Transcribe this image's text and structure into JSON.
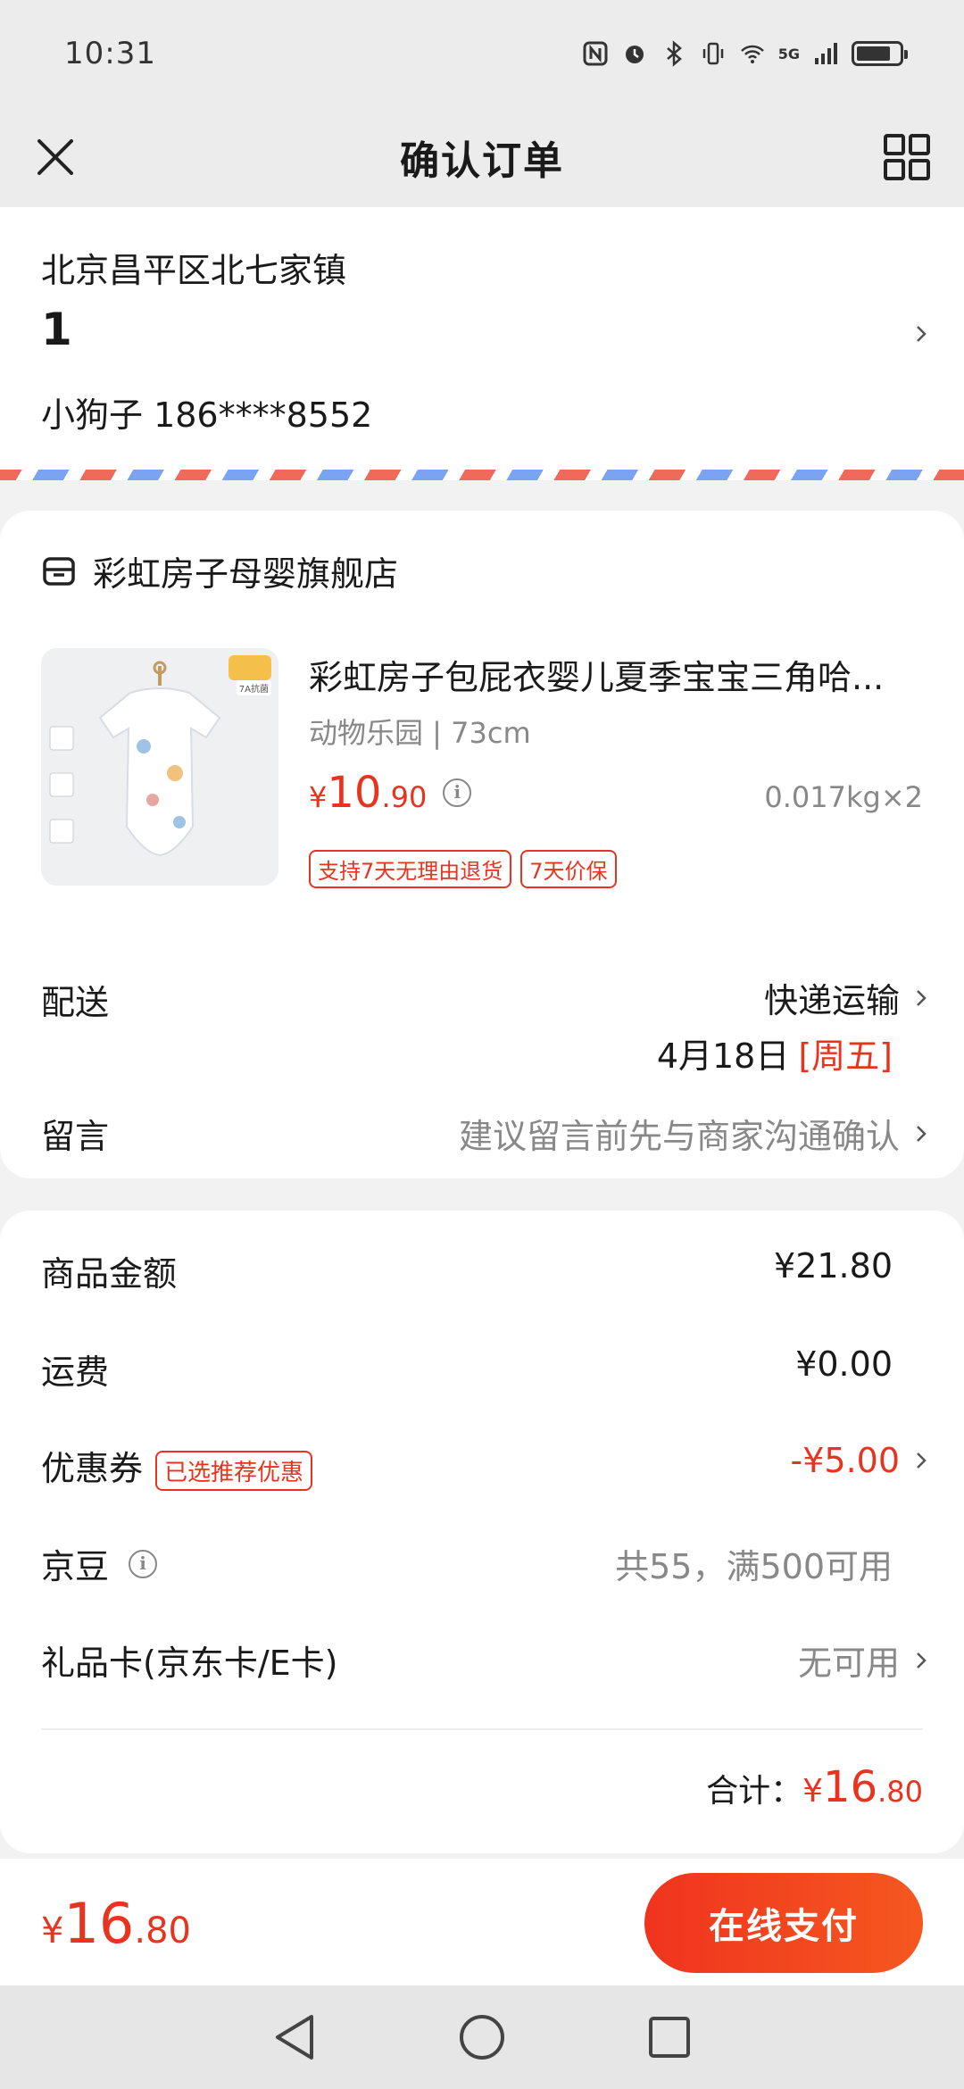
{
  "status_bar": {
    "time": "10:31",
    "network": "5G"
  },
  "header": {
    "title": "确认订单"
  },
  "address": {
    "region": "北京昌平区北七家镇",
    "detail": "1",
    "contact": "小狗子 186****8552"
  },
  "shop": {
    "name": "彩虹房子母婴旗舰店",
    "product": {
      "title": "彩虹房子包屁衣婴儿夏季宝宝三角哈...",
      "spec": "动物乐园 | 73cm",
      "price_currency": "¥",
      "price_int": "10",
      "price_dec": ".90",
      "weight": "0.017kg×2",
      "tags": [
        "支持7天无理由退货",
        "7天价保"
      ],
      "image_badge": "7A抗菌"
    },
    "delivery": {
      "label": "配送",
      "method": "快递运输",
      "date": "4月18日",
      "weekday": "[周五]"
    },
    "message": {
      "label": "留言",
      "placeholder": "建议留言前先与商家沟通确认"
    }
  },
  "pricing": {
    "goods": {
      "label": "商品金额",
      "value": "¥21.80"
    },
    "shipping": {
      "label": "运费",
      "value": "¥0.00"
    },
    "coupon": {
      "label": "优惠券",
      "tag": "已选推荐优惠",
      "value": "-¥5.00"
    },
    "jingdou": {
      "label": "京豆",
      "value": "共55，满500可用"
    },
    "giftcard": {
      "label": "礼品卡(京东卡/E卡)",
      "value": "无可用"
    },
    "total": {
      "label": "合计：",
      "currency": "¥",
      "int": "16",
      "dec": ".80"
    }
  },
  "paybar": {
    "currency": "¥",
    "int": "16",
    "dec": ".80",
    "button": "在线支付"
  },
  "colors": {
    "accent": "#e8341f",
    "muted": "#888888"
  }
}
